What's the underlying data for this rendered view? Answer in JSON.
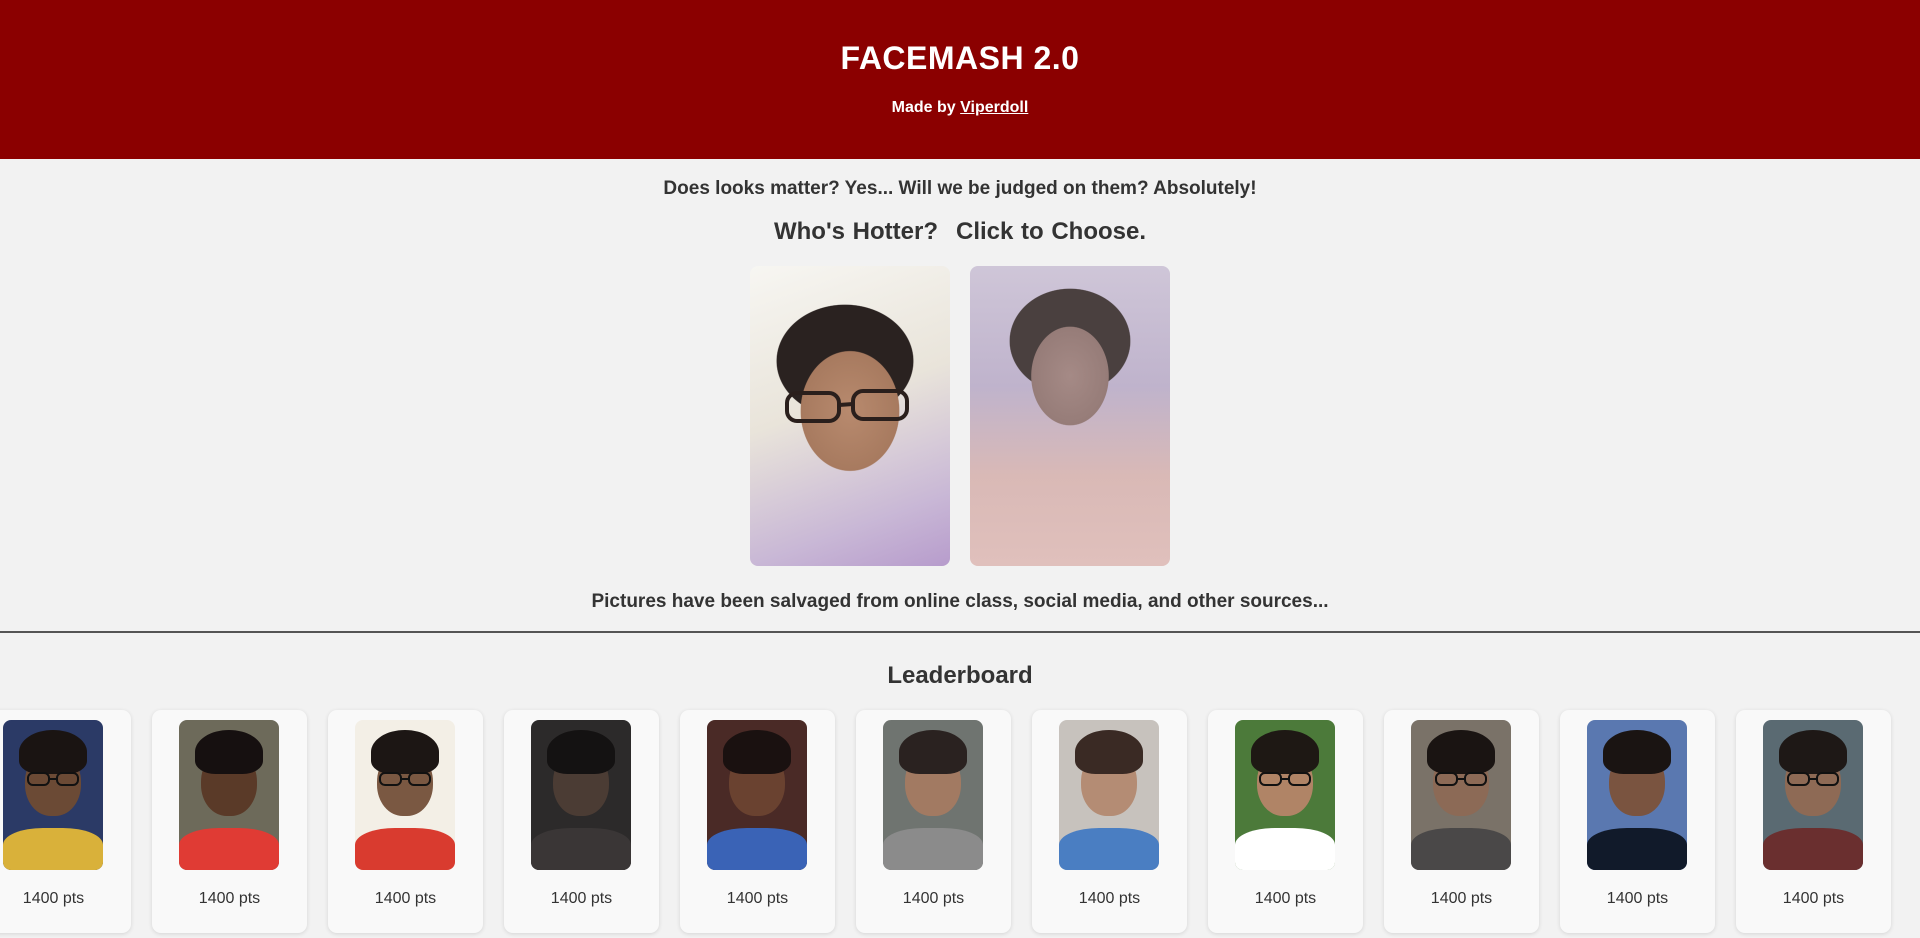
{
  "header": {
    "title": "FACEMASH 2.0",
    "credit_prefix": "Made by",
    "credit_name": "Viperdoll",
    "background_color": "#8b0000"
  },
  "main": {
    "tagline": "Does looks matter? Yes... Will we be judged on them? Absolutely!",
    "prompt_question": "Who's Hotter?",
    "prompt_action": "Click to Choose.",
    "source_note": "Pictures have been salvaged from online class, social media, and other sources..."
  },
  "leaderboard": {
    "title": "Leaderboard",
    "entries": [
      {
        "score": "1400 pts"
      },
      {
        "score": "1400 pts"
      },
      {
        "score": "1400 pts"
      },
      {
        "score": "1400 pts"
      },
      {
        "score": "1400 pts"
      },
      {
        "score": "1400 pts"
      },
      {
        "score": "1400 pts"
      },
      {
        "score": "1400 pts"
      },
      {
        "score": "1400 pts"
      },
      {
        "score": "1400 pts"
      },
      {
        "score": "1400 pts"
      }
    ]
  }
}
